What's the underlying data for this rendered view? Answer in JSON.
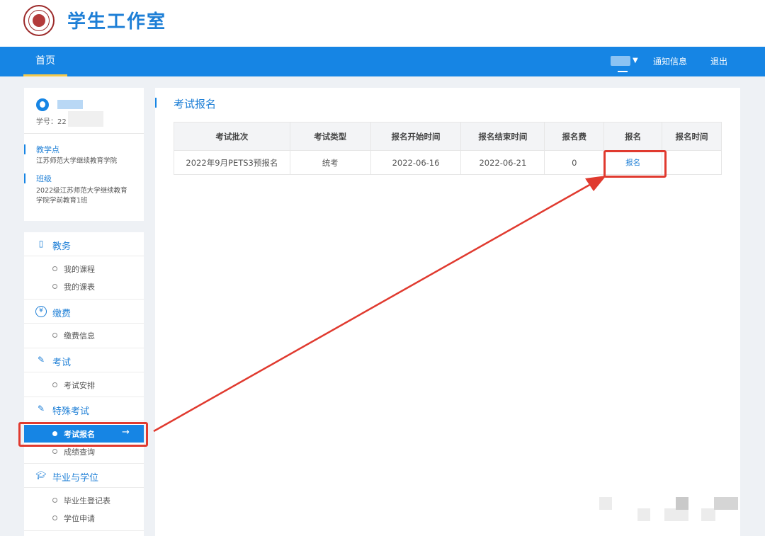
{
  "header": {
    "app_title": "学生工作室",
    "logo": "university-seal-logo"
  },
  "navbar": {
    "home": "首页",
    "notice": "通知信息",
    "logout": "退出",
    "accent": "#1685e4"
  },
  "profile": {
    "student_id_label": "学号：22",
    "section1": {
      "label": "教学点",
      "value": "江苏师范大学继续教育学院"
    },
    "section2": {
      "label": "班级",
      "value_line1": "2022级江苏师范大学继续教育",
      "value_line2": "学院学前教育1班"
    }
  },
  "menu": {
    "groups": [
      {
        "label": "教务",
        "icon": "book-gear-icon",
        "items": [
          "我的课程",
          "我的课表"
        ]
      },
      {
        "label": "缴费",
        "icon": "yen-icon",
        "items": [
          "缴费信息"
        ]
      },
      {
        "label": "考试",
        "icon": "pencil-icon",
        "items": [
          "考试安排"
        ]
      },
      {
        "label": "特殊考试",
        "icon": "pencil-icon",
        "items": [
          "考试报名",
          "成绩查询"
        ]
      },
      {
        "label": "毕业与学位",
        "icon": "graduation-cap-icon",
        "items": [
          "毕业生登记表",
          "学位申请"
        ]
      }
    ],
    "active_item": "考试报名",
    "active_arrow": "→"
  },
  "main": {
    "title": "考试报名",
    "table": {
      "headers": [
        "考试批次",
        "考试类型",
        "报名开始时间",
        "报名结束时间",
        "报名费",
        "报名",
        "报名时间"
      ],
      "rows": [
        [
          "2022年9月PETS3预报名",
          "统考",
          "2022-06-16",
          "2022-06-21",
          "0",
          "报名",
          ""
        ]
      ]
    }
  },
  "annotation_color": "#e03a2f"
}
